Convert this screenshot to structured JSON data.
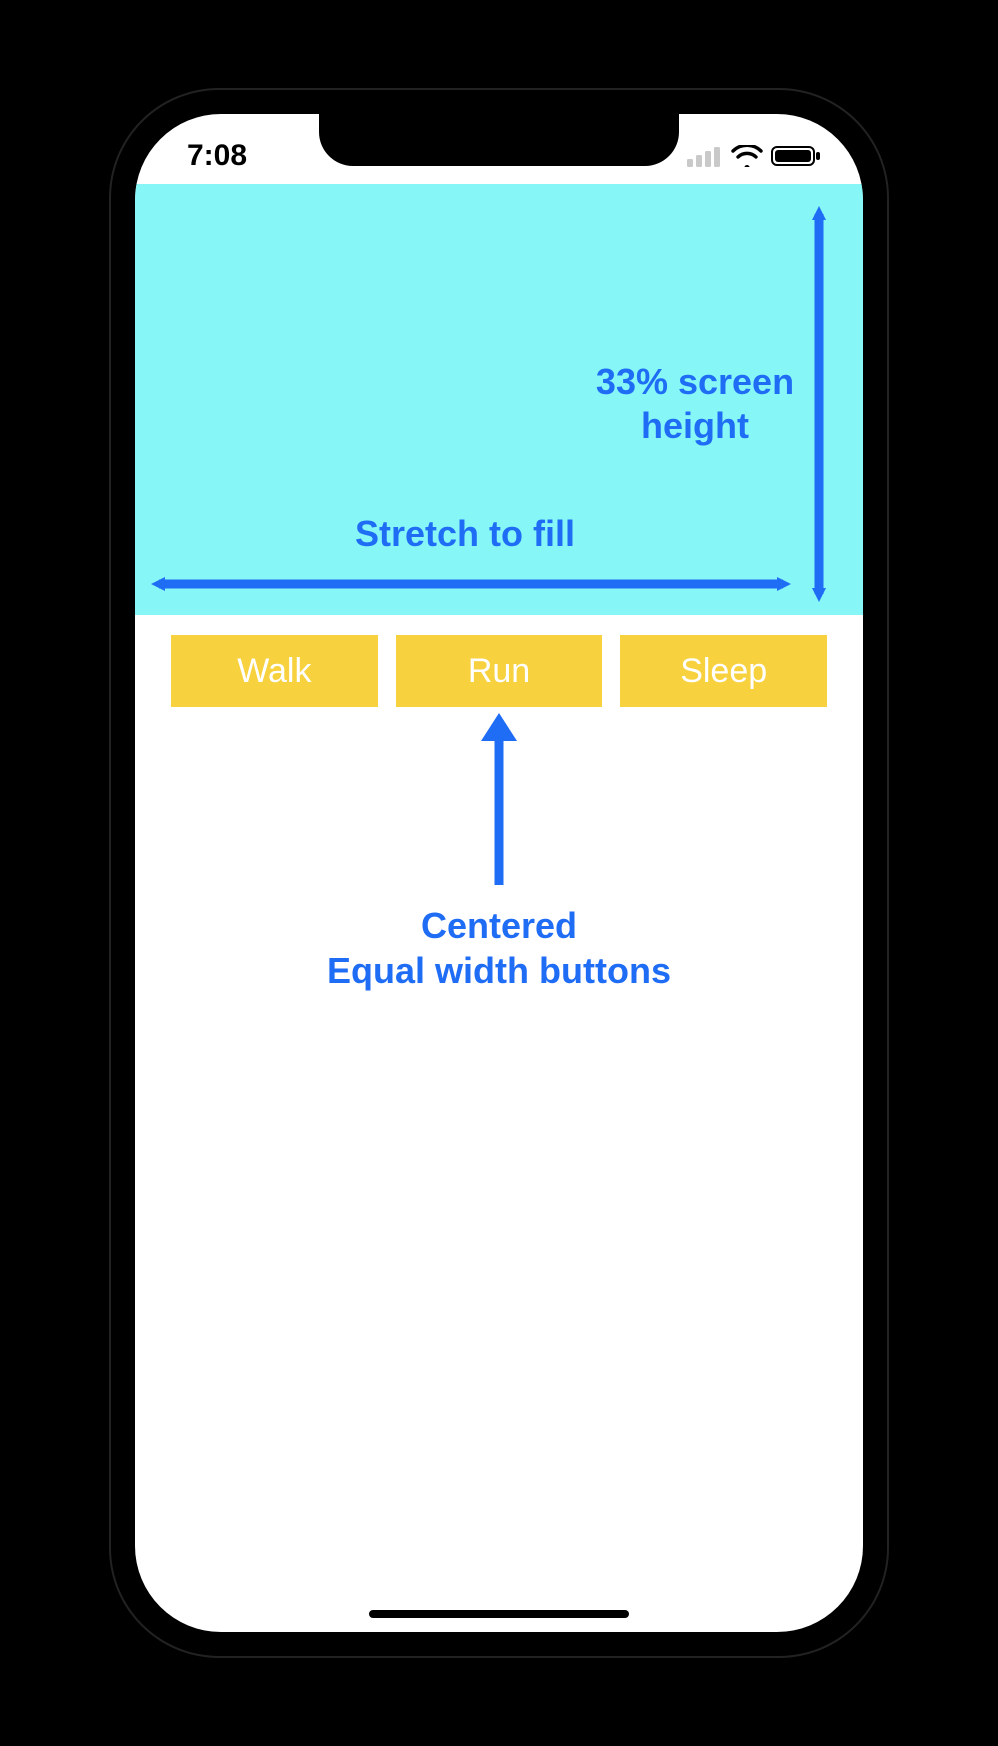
{
  "statusbar": {
    "time": "7:08"
  },
  "panel": {
    "height_label_line1": "33% screen",
    "height_label_line2": "height",
    "width_label": "Stretch to fill"
  },
  "buttons": {
    "walk": "Walk",
    "run": "Run",
    "sleep": "Sleep"
  },
  "lower": {
    "line1": "Centered",
    "line2": "Equal width buttons"
  },
  "colors": {
    "annotation": "#1f6cf5",
    "panel_bg": "#86f6f6",
    "button_bg": "#f7d13e"
  }
}
